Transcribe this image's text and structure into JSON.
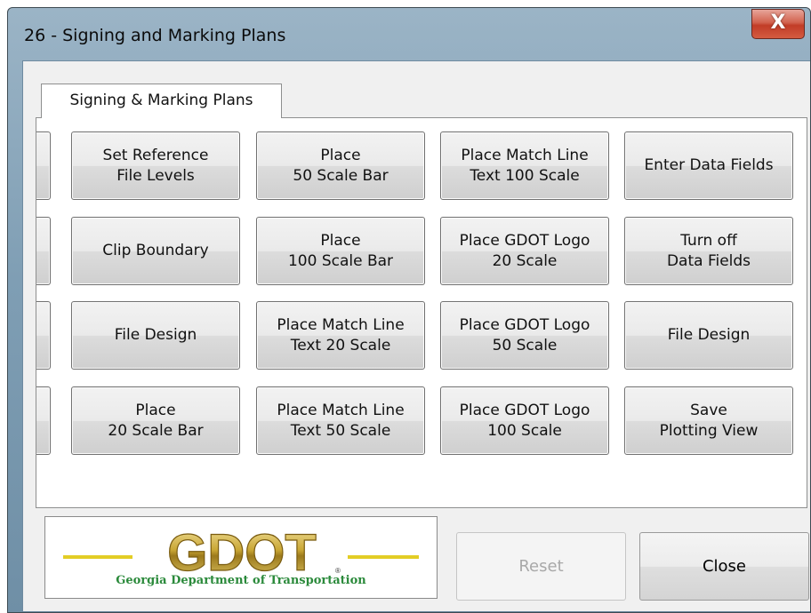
{
  "window": {
    "title": "26 - Signing and Marking Plans",
    "close_glyph": "X"
  },
  "tab": {
    "label": "Signing & Marking Plans"
  },
  "grid": {
    "rows": [
      [
        "Set Reference\nFile Levels",
        "Place\n50 Scale Bar",
        "Place Match Line\nText 100 Scale",
        "Enter Data Fields"
      ],
      [
        "Clip Boundary",
        "Place\n100 Scale Bar",
        "Place GDOT Logo\n20 Scale",
        "Turn off\nData Fields"
      ],
      [
        "File Design",
        "Place Match Line\nText 20 Scale",
        "Place GDOT Logo\n50 Scale",
        "File Design"
      ],
      [
        "Place\n20 Scale Bar",
        "Place Match Line\nText 50 Scale",
        "Place GDOT Logo\n100 Scale",
        "Save\nPlotting View"
      ]
    ]
  },
  "scrollbar": {
    "left_arrow": "◀",
    "right_arrow": "▶",
    "position_fraction": 0.0
  },
  "logo": {
    "wordmark": "GDOT",
    "caption": "Georgia Department of Transportation",
    "colors": {
      "gold": "#c9a634",
      "yellow": "#e3cd25",
      "green": "#2b8a3b"
    }
  },
  "actions": {
    "reset_label": "Reset",
    "reset_enabled": false,
    "close_label": "Close"
  }
}
